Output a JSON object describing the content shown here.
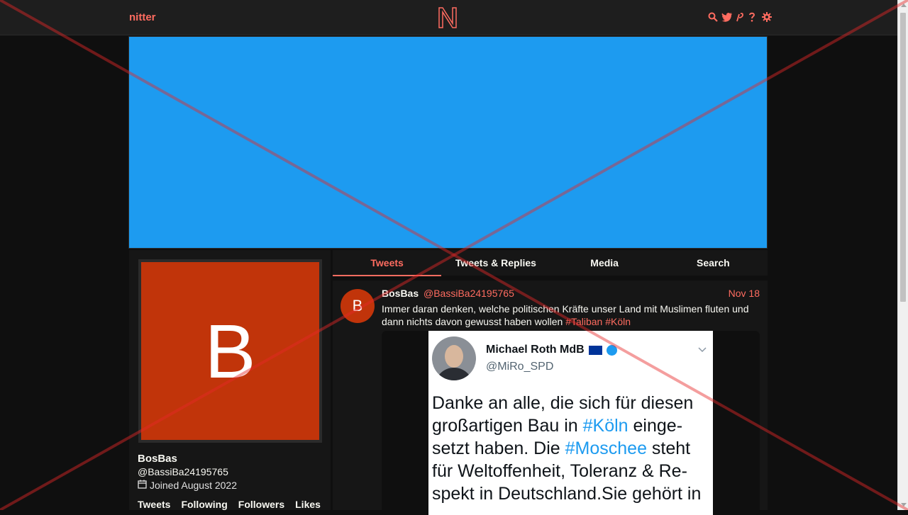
{
  "nav": {
    "brand": "nitter",
    "icons": [
      "search-icon",
      "twitter-icon",
      "rss-icon",
      "help-icon",
      "gear-icon"
    ]
  },
  "colors": {
    "accent": "#ff6c60",
    "banner": "#1d9bf0",
    "avatar_bg": "#c1340a",
    "background": "#0f0f0f",
    "panel": "#161616"
  },
  "profile": {
    "avatar_letter": "B",
    "name": "BosBas",
    "handle": "@BassiBa24195765",
    "joined": "Joined August 2022",
    "stats": [
      "Tweets",
      "Following",
      "Followers",
      "Likes"
    ]
  },
  "tabs": [
    "Tweets",
    "Tweets & Replies",
    "Media",
    "Search"
  ],
  "tweet": {
    "avatar_letter": "B",
    "name": "BosBas",
    "handle": "@BassiBa24195765",
    "date": "Nov 18",
    "text": "Immer daran denken, welche politischen Kräfte unser Land mit Muslimen fluten und dann nichts davon gewusst haben wollen",
    "hashtags": [
      "#Taliban",
      "#Köln"
    ],
    "embed": {
      "name": "Michael Roth MdB",
      "handle": "@MiRo_SPD",
      "lines": [
        "Danke an alle, die sich für diesen",
        "großartigen Bau in ",
        "#Köln",
        " einge-",
        "setzt haben. Die ",
        "#Moschee",
        " steht",
        "für Weltoffenheit, Toleranz & Re-",
        "spekt in Deutschland.Sie gehört in"
      ]
    }
  }
}
